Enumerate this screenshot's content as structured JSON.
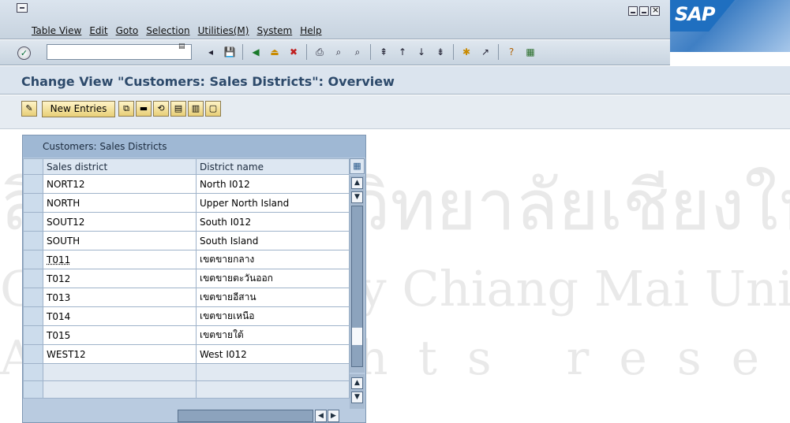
{
  "menu": {
    "items": [
      "Table View",
      "Edit",
      "Goto",
      "Selection",
      "Utilities(M)",
      "System",
      "Help"
    ]
  },
  "brand": "SAP",
  "std_toolbar": {
    "command_value": "",
    "icons": [
      "enter-icon",
      "command-toggle-icon",
      "back-nav-icon",
      "save-icon",
      "back-icon",
      "exit-icon",
      "cancel-icon",
      "print-icon",
      "find-icon",
      "find-next-icon",
      "first-page-icon",
      "previous-page-icon",
      "next-page-icon",
      "last-page-icon",
      "create-session-icon",
      "shortcut-icon",
      "help-icon",
      "layout-menu-icon"
    ]
  },
  "screen": {
    "title": "Change View \"Customers: Sales Districts\": Overview"
  },
  "app_toolbar": {
    "new_entries_label": "New Entries",
    "icons": [
      "change-display-icon",
      "copy-as-icon",
      "delete-icon",
      "undo-change-icon",
      "select-all-icon",
      "select-block-icon",
      "deselect-all-icon"
    ]
  },
  "table": {
    "title": "Customers: Sales Districts",
    "columns": [
      "Sales district",
      "District name"
    ],
    "rows": [
      {
        "district": "NORT12",
        "name": "North I012"
      },
      {
        "district": "NORTH",
        "name": "Upper North Island"
      },
      {
        "district": "SOUT12",
        "name": "South I012"
      },
      {
        "district": "SOUTH",
        "name": "South Island"
      },
      {
        "district": "T011",
        "name": "เขตขายกลาง"
      },
      {
        "district": "T012",
        "name": "เขตขายตะวันออก"
      },
      {
        "district": "T013",
        "name": "เขตขายอีสาน"
      },
      {
        "district": "T014",
        "name": "เขตขายเหนือ"
      },
      {
        "district": "T015",
        "name": "เขตขายใต้"
      },
      {
        "district": "WEST12",
        "name": "West I012"
      },
      {
        "district": "",
        "name": ""
      },
      {
        "district": "",
        "name": ""
      }
    ]
  },
  "watermark": {
    "line1": "ลิขสิทธิ์มหาวิทยาลัยเชียงใหม่",
    "line2": "Copyright © by Chiang Mai University",
    "line3": "All rights reserved"
  },
  "colors": {
    "title_text": "#2d4a6b",
    "table_header": "#9fb8d4"
  }
}
